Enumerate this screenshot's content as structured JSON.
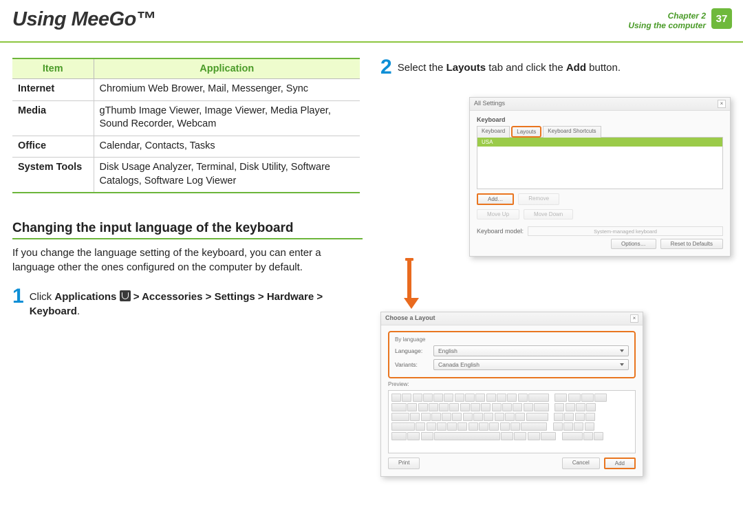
{
  "header": {
    "title": "Using MeeGo™",
    "chapter_line1": "Chapter 2",
    "chapter_line2": "Using the computer",
    "page_number": "37"
  },
  "table": {
    "head_item": "Item",
    "head_app": "Application",
    "rows": [
      {
        "item": "Internet",
        "app": "Chromium Web Brower, Mail, Messenger, Sync"
      },
      {
        "item": "Media",
        "app": "gThumb Image Viewer, Image Viewer, Media Player, Sound Recorder, Webcam"
      },
      {
        "item": "Office",
        "app": "Calendar, Contacts, Tasks"
      },
      {
        "item": "System Tools",
        "app": "Disk Usage Analyzer, Terminal, Disk Utility, Software Catalogs, Software Log Viewer"
      }
    ]
  },
  "section": {
    "heading": "Changing the input language of the keyboard",
    "paragraph": "If you change the language setting of the keyboard, you can enter a language other the ones configured on the computer by default."
  },
  "steps": {
    "s1_num": "1",
    "s1_a": "Click ",
    "s1_b": "Applications",
    "s1_c": " > Accessories > Settings > Hardware > Keyboard",
    "s1_d": ".",
    "s2_num": "2",
    "s2_a": "Select the ",
    "s2_b": "Layouts",
    "s2_c": " tab and click the ",
    "s2_d": "Add",
    "s2_e": " button."
  },
  "dlg1": {
    "all_settings": "All Settings",
    "keyboard_label": "Keyboard",
    "tab_keyboard": "Keyboard",
    "tab_layouts": "Layouts",
    "tab_shortcuts": "Keyboard Shortcuts",
    "row": "USA",
    "btn_add": "Add…",
    "btn_remove": "Remove",
    "btn_moveup": "Move Up",
    "btn_movedown": "Move Down",
    "kb_model_lab": "Keyboard model:",
    "kb_model_val": "System-managed keyboard",
    "btn_options": "Options…",
    "btn_reset": "Reset to Defaults"
  },
  "dlg2": {
    "title": "Choose a Layout",
    "by_language": "By language",
    "language_lab": "Language:",
    "language_val": "English",
    "variants_lab": "Variants:",
    "variants_val": "Canada English",
    "preview": "Preview:",
    "btn_print": "Print",
    "btn_cancel": "Cancel",
    "btn_add": "Add"
  }
}
